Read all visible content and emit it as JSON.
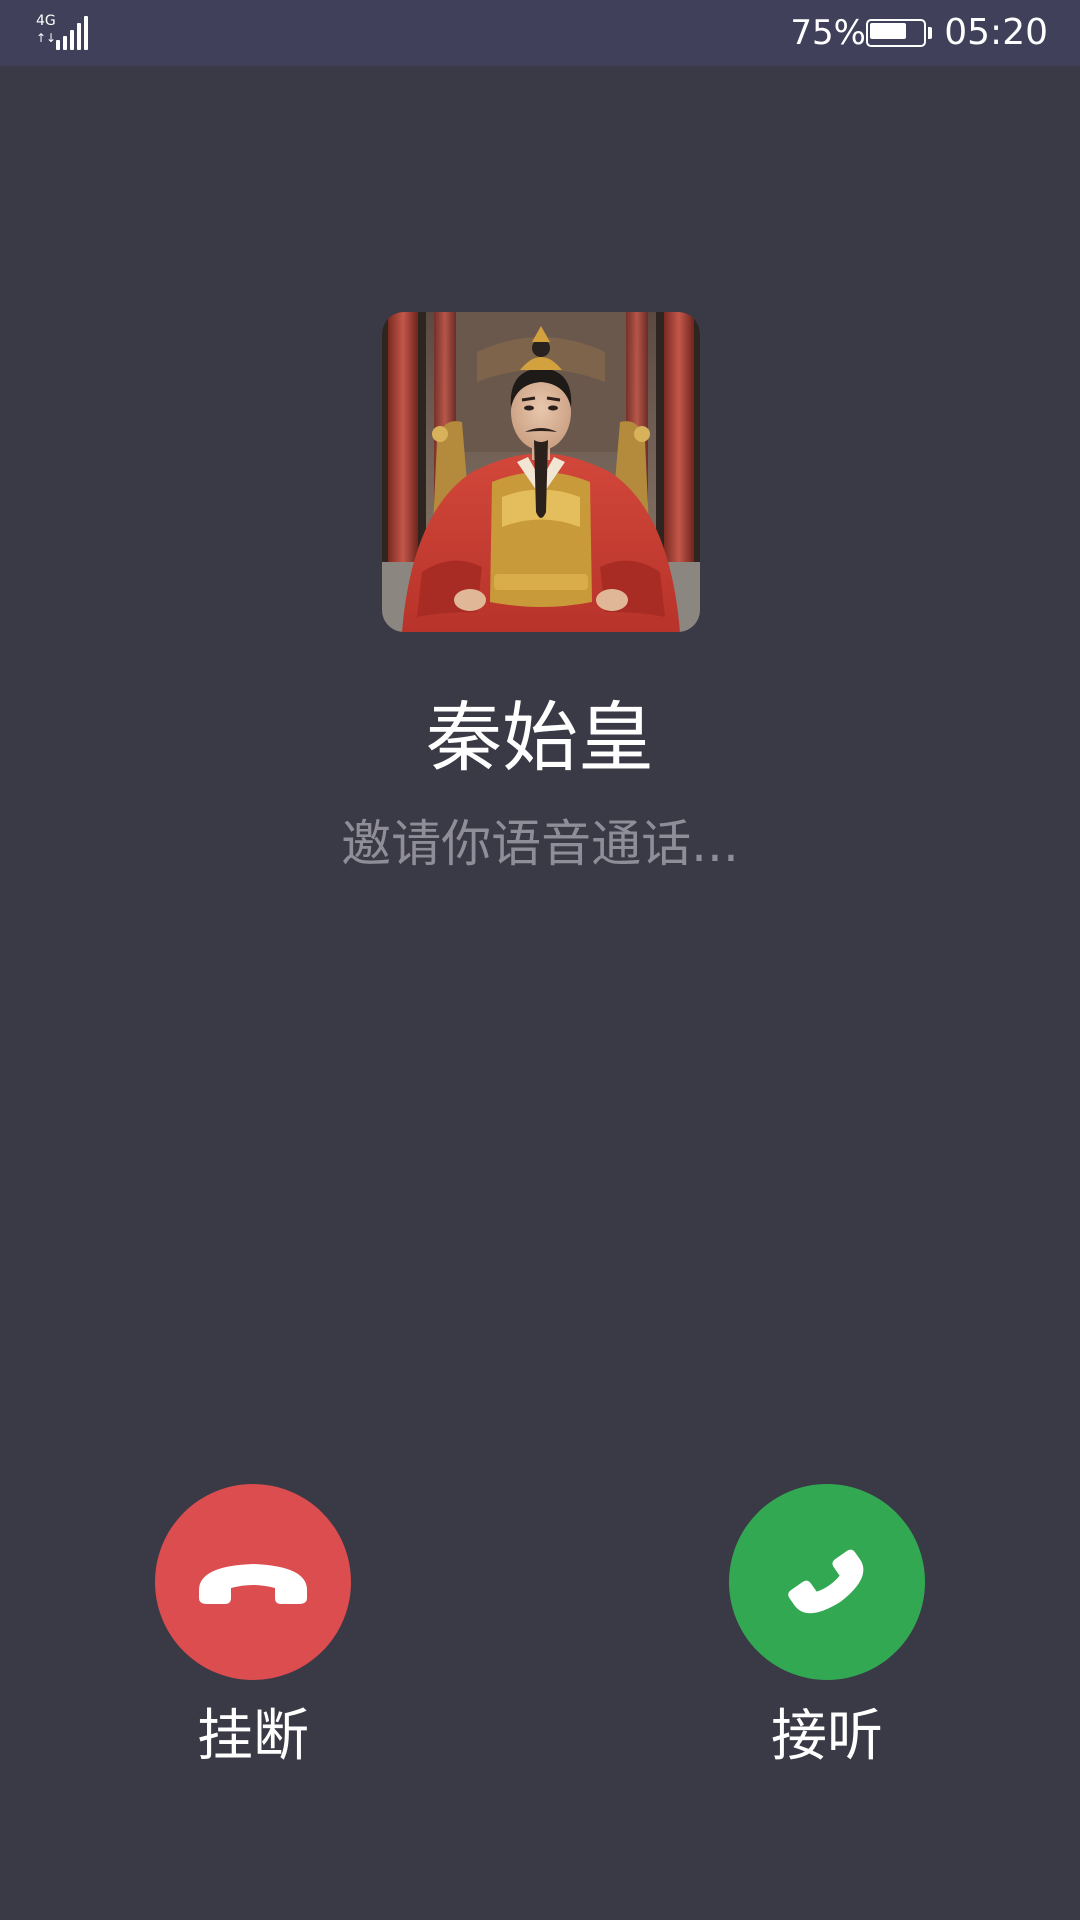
{
  "status_bar": {
    "network_type": "4G",
    "network_activity": "↑↓",
    "signal_bars": 5,
    "battery_percent_text": "75%",
    "battery_level": 0.75,
    "time": "05:20"
  },
  "caller": {
    "name": "秦始皇",
    "status": "邀请你语音通话..."
  },
  "actions": {
    "decline_label": "挂断",
    "accept_label": "接听"
  },
  "colors": {
    "background": "#3a3946",
    "status_bar": "#41405a",
    "decline": "#db4d4e",
    "accept": "#33a852",
    "status_text": "#8f8e98"
  },
  "icons": {
    "signal": "cell-signal-icon",
    "battery": "battery-icon",
    "decline": "phone-hangup-icon",
    "accept": "phone-answer-icon"
  }
}
